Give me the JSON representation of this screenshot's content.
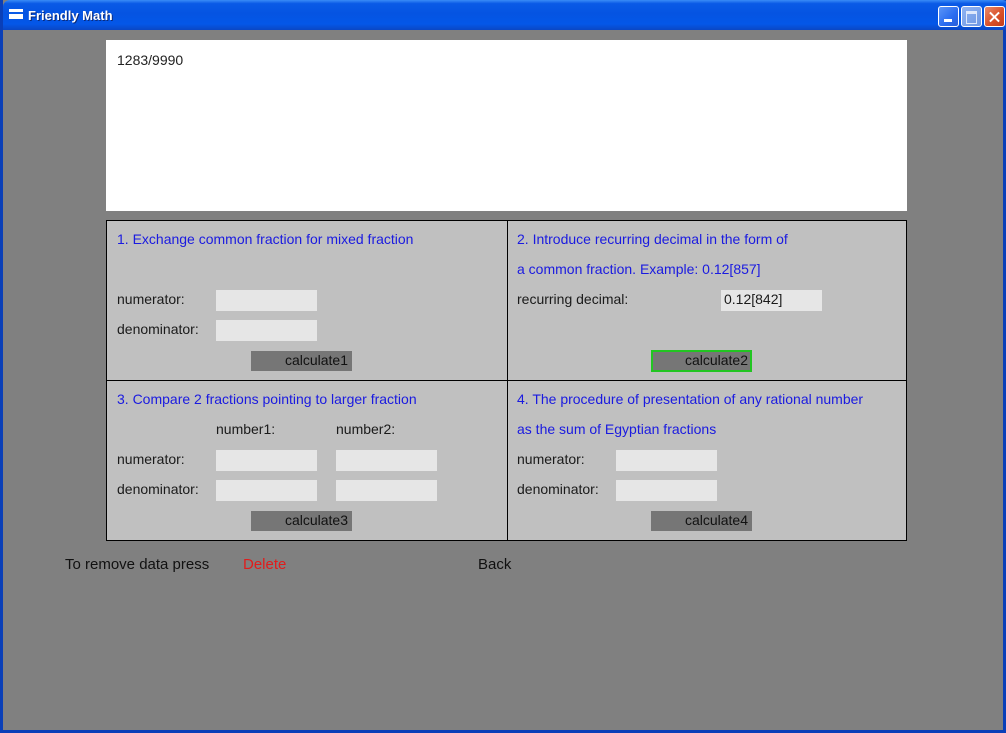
{
  "window": {
    "title": "Friendly Math"
  },
  "display": {
    "value": "1283/9990"
  },
  "panel1": {
    "title": "1. Exchange common fraction for mixed fraction",
    "numerator_label": "numerator:",
    "denominator_label": "denominator:",
    "numerator_value": "",
    "denominator_value": "",
    "button_label": "calculate1"
  },
  "panel2": {
    "title_line1": "2. Introduce recurring decimal in the form of",
    "title_line2": "a common fraction. Example: 0.12[857]",
    "decimal_label": "recurring decimal:",
    "decimal_value": "0.12[842]",
    "button_label": "calculate2"
  },
  "panel3": {
    "title": "3. Compare 2 fractions pointing to larger fraction",
    "number1_label": "number1:",
    "number2_label": "number2:",
    "numerator_label": "numerator:",
    "denominator_label": "denominator:",
    "num1_numerator": "",
    "num2_numerator": "",
    "num1_denominator": "",
    "num2_denominator": "",
    "button_label": "calculate3"
  },
  "panel4": {
    "title_line1": "4. The procedure of presentation of any rational number",
    "title_line2": "as the sum of Egyptian fractions",
    "numerator_label": "numerator:",
    "denominator_label": "denominator:",
    "numerator_value": "",
    "denominator_value": "",
    "button_label": "calculate4"
  },
  "footer": {
    "remove_text": "To remove data press",
    "delete_label": "Delete",
    "back_label": "Back"
  },
  "colors": {
    "title_text": "#1a1ae0",
    "delete": "#e11c1c",
    "focus_border": "#22c522"
  }
}
